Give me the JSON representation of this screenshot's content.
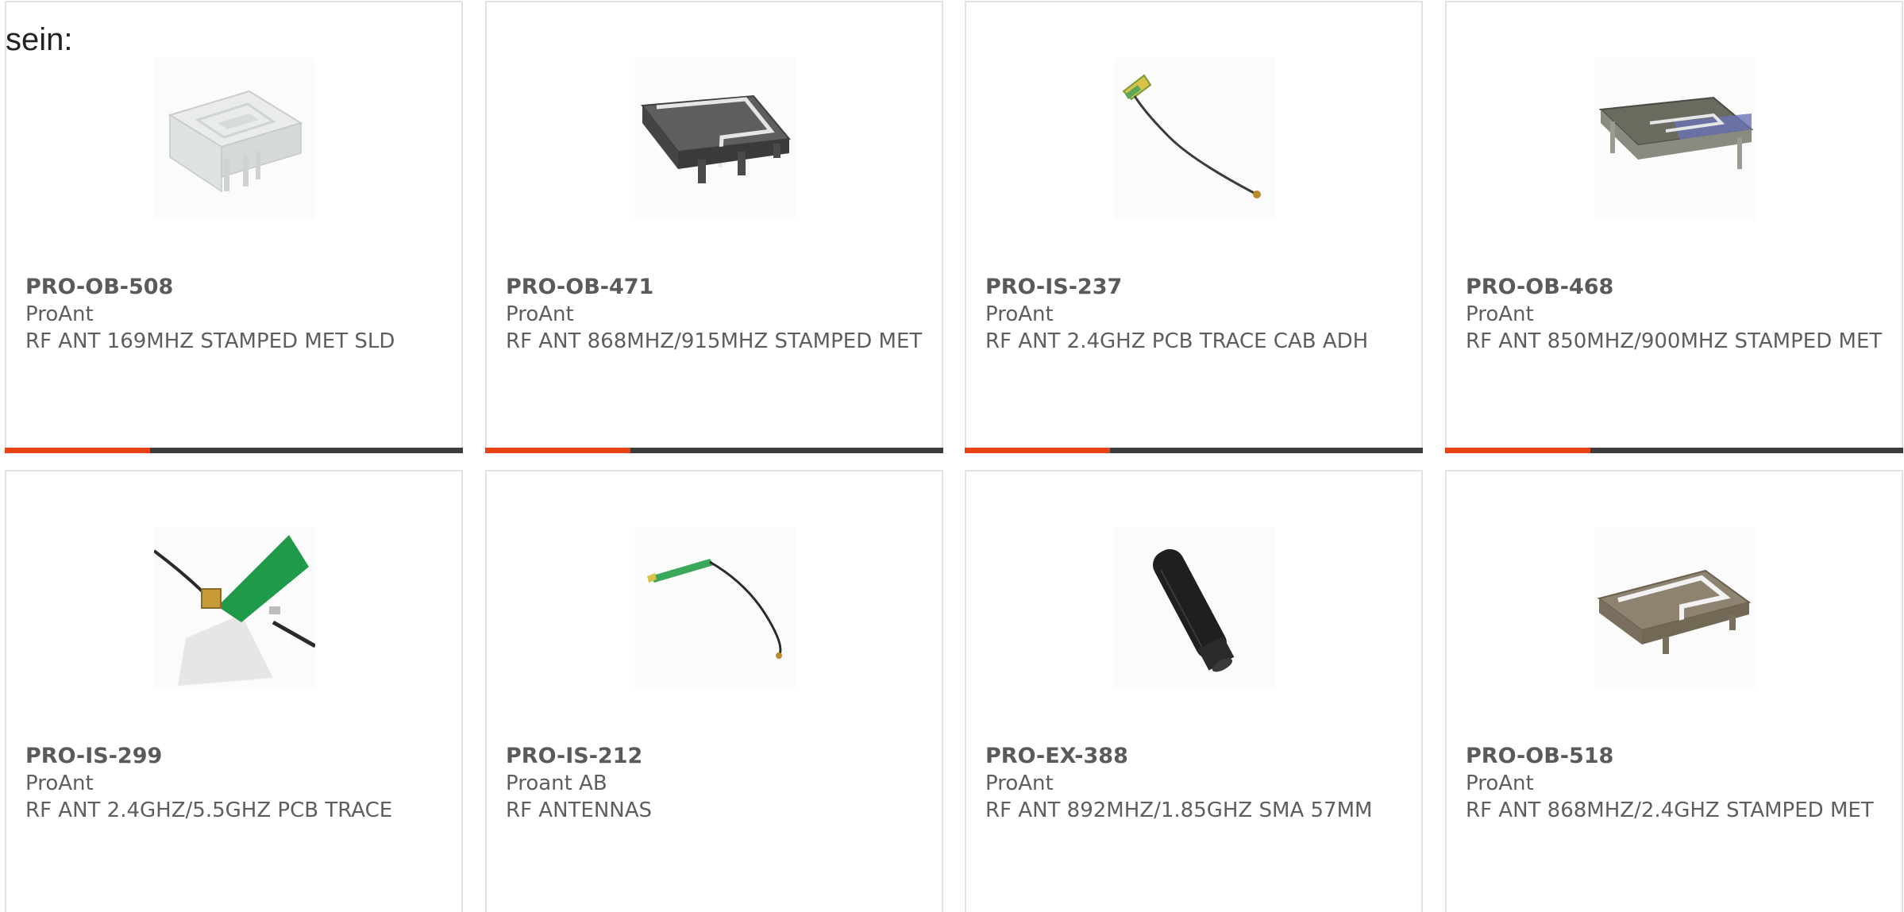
{
  "intro_text": "sein:",
  "products": [
    {
      "part": "PRO-OB-508",
      "manufacturer": "ProAnt",
      "description": "RF ANT 169MHZ STAMPED MET SLD",
      "image": "stamped-metal-shield-antenna"
    },
    {
      "part": "PRO-OB-471",
      "manufacturer": "ProAnt",
      "description": "RF ANT 868MHZ/915MHZ STAMPED MET",
      "image": "stamped-metal-antenna-dark"
    },
    {
      "part": "PRO-IS-237",
      "manufacturer": "ProAnt",
      "description": "RF ANT 2.4GHZ PCB TRACE CAB ADH",
      "image": "pcb-trace-cable-antenna"
    },
    {
      "part": "PRO-OB-468",
      "manufacturer": "ProAnt",
      "description": "RF ANT 850MHZ/900MHZ STAMPED MET",
      "image": "stamped-metal-antenna-dark"
    },
    {
      "part": "PRO-IS-299",
      "manufacturer": "ProAnt",
      "description": "RF ANT 2.4GHZ/5.5GHZ PCB TRACE",
      "image": "green-pcb-antenna"
    },
    {
      "part": "PRO-IS-212",
      "manufacturer": "Proant AB",
      "description": "RF ANTENNAS",
      "image": "pcb-cable-antenna"
    },
    {
      "part": "PRO-EX-388",
      "manufacturer": "ProAnt",
      "description": "RF ANT 892MHZ/1.85GHZ SMA 57MM",
      "image": "sma-whip-antenna"
    },
    {
      "part": "PRO-OB-518",
      "manufacturer": "ProAnt",
      "description": "RF ANT 868MHZ/2.4GHZ STAMPED MET",
      "image": "stamped-metal-antenna-bronze"
    }
  ],
  "colors": {
    "accent": "#e84314",
    "bar": "#3d3d3d",
    "border": "#e3e3e3",
    "text": "#5e5e5e"
  }
}
